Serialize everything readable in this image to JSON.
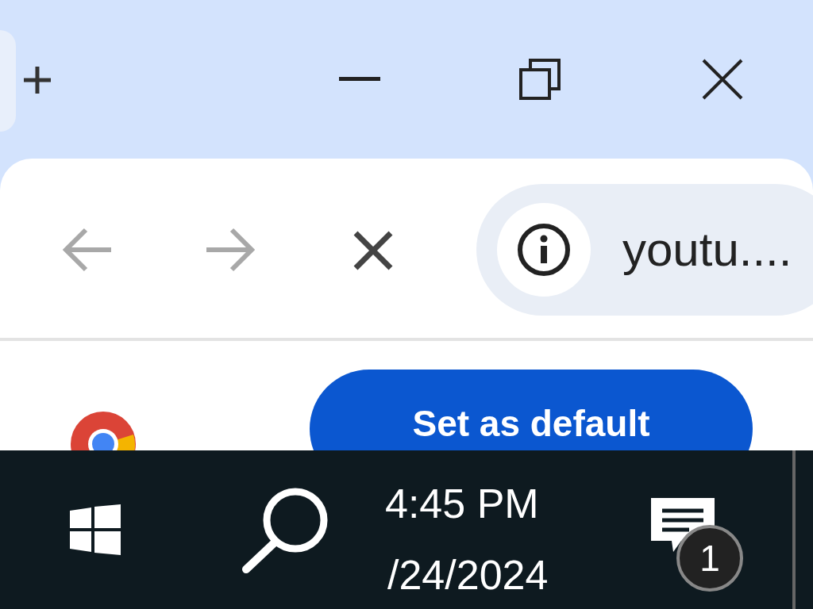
{
  "address_bar": {
    "url": "youtu...."
  },
  "page": {
    "default_button": "Set as default"
  },
  "taskbar": {
    "time": "4:45 PM",
    "date": "/24/2024",
    "notification_count": "1"
  }
}
